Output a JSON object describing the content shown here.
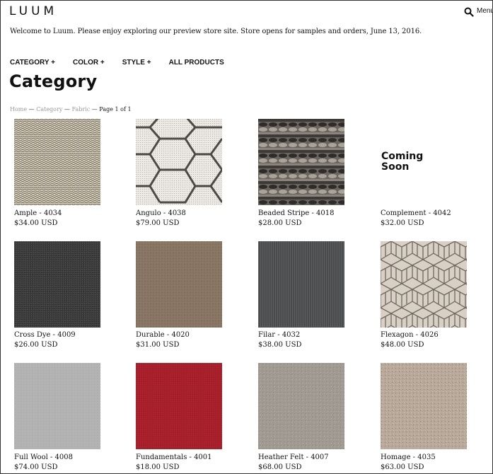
{
  "header": {
    "logo": "LUUM",
    "menu_label": "Menu",
    "welcome": "Welcome to Luum. Please enjoy exploring our preview store site. Store opens for samples and orders, June 13, 2016."
  },
  "nav": [
    {
      "label": "CATEGORY +"
    },
    {
      "label": "COLOR +"
    },
    {
      "label": "STYLE +"
    },
    {
      "label": "ALL PRODUCTS"
    }
  ],
  "page_title": "Category",
  "breadcrumb": {
    "home": "Home",
    "category": "Category",
    "fabric": "Fabric",
    "sep": " — ",
    "page": "Page 1 of 1"
  },
  "coming_soon": "Coming\nSoon",
  "colors": {
    "text": "#111111",
    "breadcrumb_link": "#999999"
  },
  "products": [
    {
      "name": "Ample - 4034",
      "price": "$34.00 USD",
      "image": "ample-swatch"
    },
    {
      "name": "Angulo - 4038",
      "price": "$79.00 USD",
      "image": "angulo-swatch"
    },
    {
      "name": "Beaded Stripe - 4018",
      "price": "$28.00 USD",
      "image": "beaded-stripe-swatch"
    },
    {
      "name": "Complement - 4042",
      "price": "$32.00 USD",
      "image": "coming-soon"
    },
    {
      "name": "Cross Dye - 4009",
      "price": "$26.00 USD",
      "image": "cross-dye-swatch"
    },
    {
      "name": "Durable - 4020",
      "price": "$31.00 USD",
      "image": "durable-swatch"
    },
    {
      "name": "Filar - 4032",
      "price": "$38.00 USD",
      "image": "filar-swatch"
    },
    {
      "name": "Flexagon - 4026",
      "price": "$48.00 USD",
      "image": "flexagon-swatch"
    },
    {
      "name": "Full Wool - 4008",
      "price": "$74.00 USD",
      "image": "full-wool-swatch"
    },
    {
      "name": "Fundamentals - 4001",
      "price": "$18.00 USD",
      "image": "fundamentals-swatch"
    },
    {
      "name": "Heather Felt - 4007",
      "price": "$68.00 USD",
      "image": "heather-felt-swatch"
    },
    {
      "name": "Homage - 4035",
      "price": "$63.00 USD",
      "image": "homage-swatch"
    }
  ]
}
